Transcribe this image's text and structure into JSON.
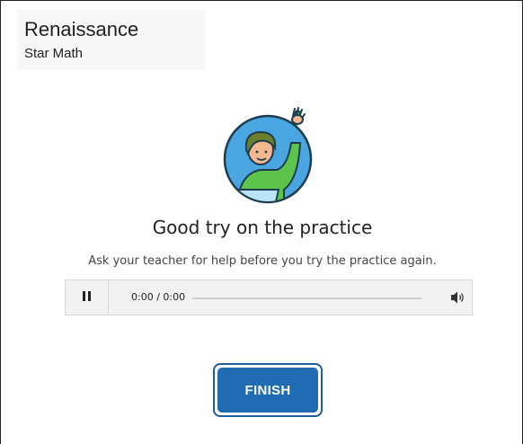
{
  "header": {
    "brand_title": "Renaissance",
    "brand_subtitle": "Star Math"
  },
  "result": {
    "headline": "Good try on the practice",
    "message": "Ask your teacher for help before you try the practice again."
  },
  "audio_player": {
    "time_display": "0:00 / 0:00",
    "state": "playing",
    "progress": 0
  },
  "actions": {
    "finish_label": "FINISH"
  },
  "colors": {
    "finish_button": "#1f6cb3",
    "finish_border": "#1c5e9e",
    "illustration_circle": "#4aa6e0",
    "illustration_shirt": "#5cc44a"
  },
  "icons": {
    "illustration": "student-raising-hand",
    "pause": "pause-icon",
    "volume": "volume-icon"
  }
}
